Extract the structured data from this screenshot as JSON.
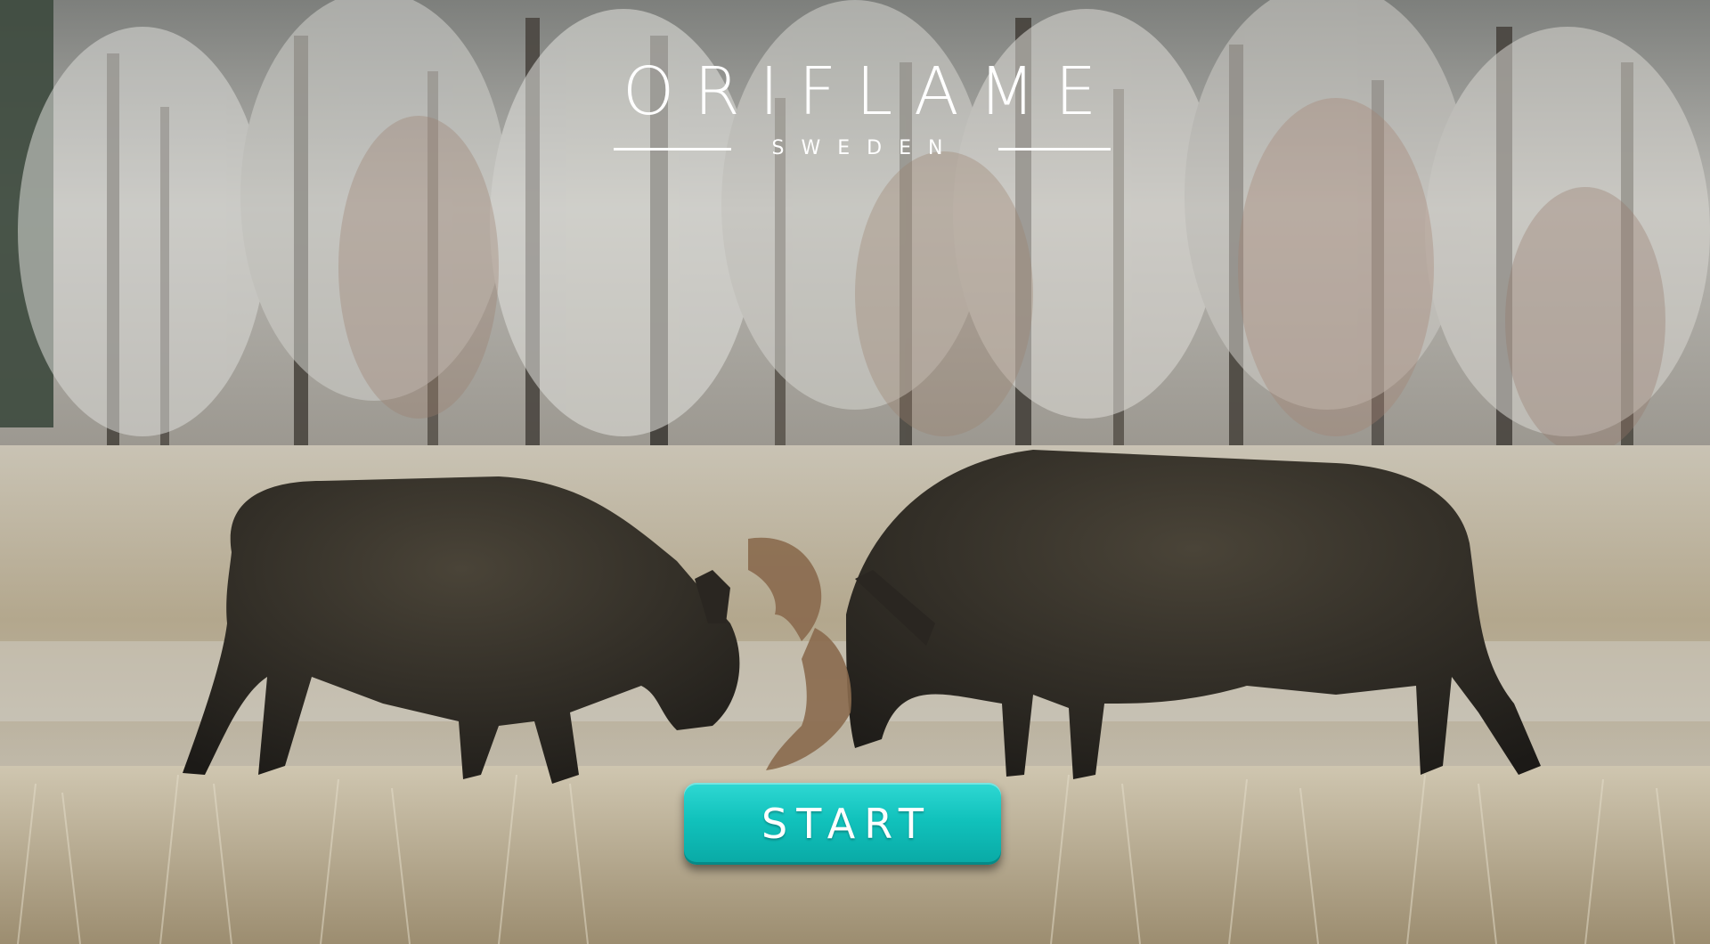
{
  "logo": {
    "brand": "ORIFLAME",
    "tagline": "SWEDEN"
  },
  "start_button": {
    "label": "START",
    "color": "#11c2bc"
  },
  "scene": {
    "background": "moose-fight-winter-forest"
  }
}
